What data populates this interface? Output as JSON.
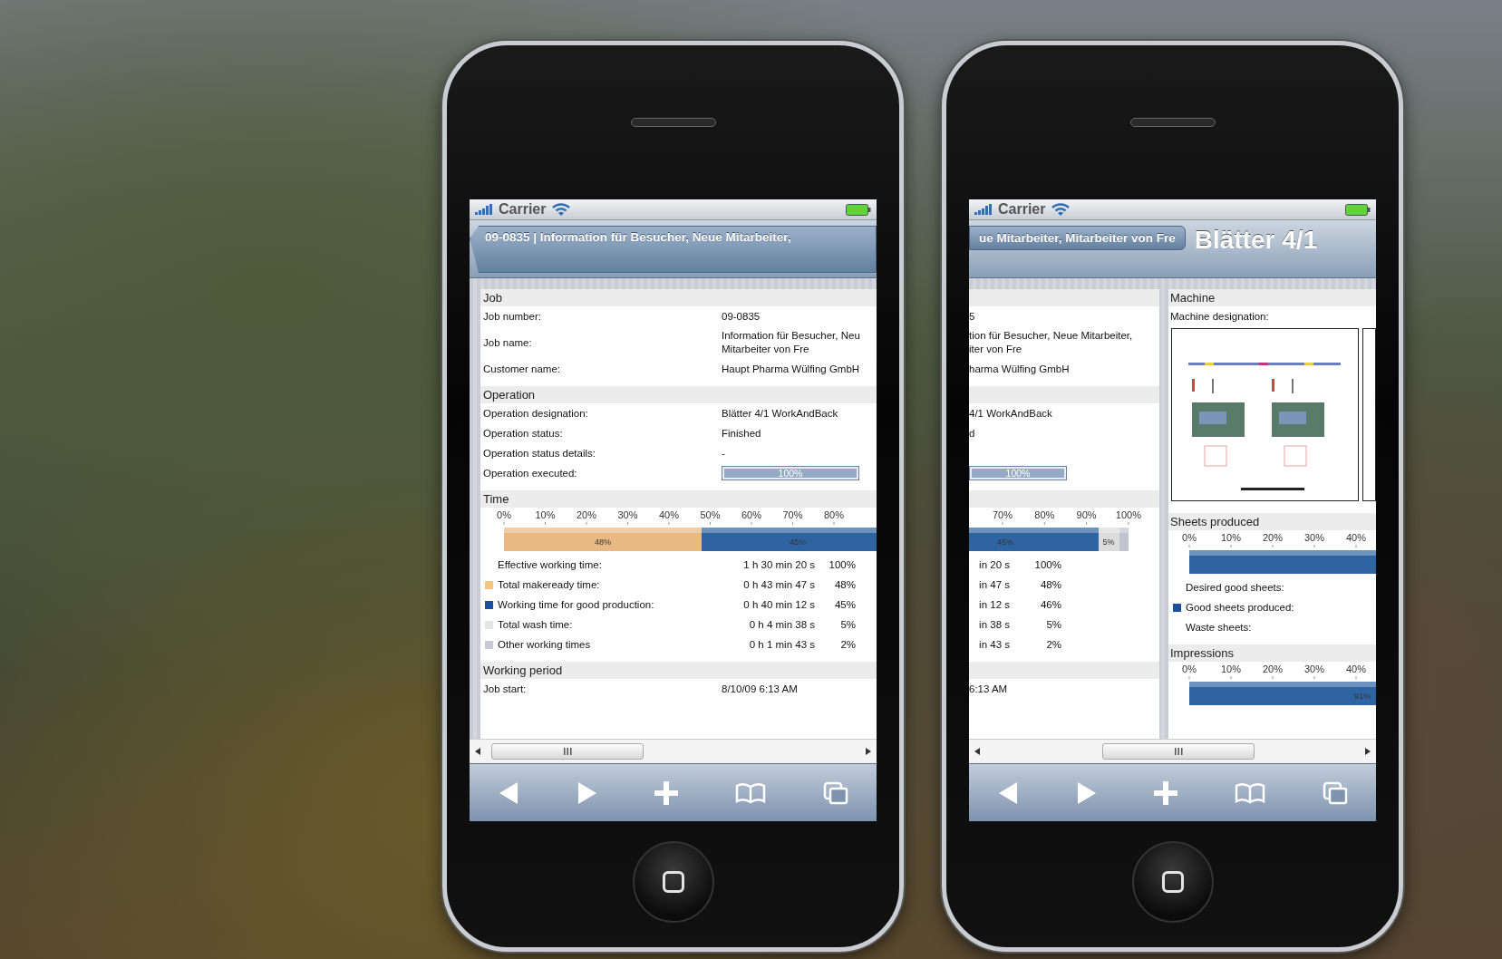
{
  "phones": [
    {
      "status_bar": {
        "carrier": "Carrier"
      },
      "nav": {
        "back_label": "09-0835 | Information für Besucher, Neue Mitarbeiter,"
      },
      "columns": [
        {
          "blocks": [
            {
              "kind": "info",
              "title": "Job",
              "rows": [
                {
                  "kind": "text",
                  "label": "Job number:",
                  "value": "09-0835"
                },
                {
                  "kind": "text",
                  "label": "Job name:",
                  "value_lines": [
                    "Information für Besucher, Neu",
                    "Mitarbeiter von Fre"
                  ]
                },
                {
                  "kind": "text",
                  "label": "Customer name:",
                  "value": "Haupt Pharma Wülfing GmbH"
                }
              ]
            },
            {
              "kind": "info",
              "title": "Operation",
              "rows": [
                {
                  "kind": "text",
                  "label": "Operation designation:",
                  "value": "Blätter 4/1 WorkAndBack"
                },
                {
                  "kind": "text",
                  "label": "Operation status:",
                  "value": "Finished"
                },
                {
                  "kind": "text",
                  "label": "Operation status details:",
                  "value": "-"
                },
                {
                  "kind": "progress",
                  "label": "Operation executed:",
                  "level": 1,
                  "reading": "100%"
                }
              ]
            },
            {
              "kind": "picture_chart",
              "title": "Time",
              "ticks": [
                "0%",
                "10%",
                "20%",
                "30%",
                "40%",
                "50%",
                "60%",
                "70%",
                "80%"
              ],
              "segments": [
                {
                  "color": "#e9b983",
                  "label": "48%"
                },
                {
                  "color": "#2f64a3",
                  "label": "45%"
                }
              ],
              "legend": [
                {
                  "label": "Effective working time:",
                  "time": "1 h 30 min 20 s",
                  "percent": "100%"
                },
                {
                  "color": "#f5c27f",
                  "label": "Total makeready time:",
                  "time": "0 h 43 min 47 s",
                  "percent": "48%"
                },
                {
                  "color": "#1d4f9c",
                  "label": "Working time for good production:",
                  "time": "0 h 40 min 12 s",
                  "percent": "45%"
                },
                {
                  "color": "#e6e6e6",
                  "label": "Total wash time:",
                  "time": "0 h 4 min 38 s",
                  "percent": "5%"
                },
                {
                  "color": "#c9c9d6",
                  "label": "Other working times",
                  "time": "0 h 1 min 43 s",
                  "percent": "2%"
                }
              ]
            },
            {
              "kind": "info",
              "title": "Working period",
              "rows": [
                {
                  "kind": "text",
                  "label": "Job start:",
                  "value": "8/10/09 6:13 AM"
                }
              ]
            }
          ]
        }
      ]
    },
    {
      "status_bar": {
        "carrier": "Carrier"
      },
      "nav": {
        "back_label": "ue Mitarbeiter, Mitarbeiter von Fre",
        "title": "Blätter 4/1"
      },
      "columns": [
        {
          "blocks": [
            {
              "kind": "info",
              "rows": [
                {
                  "kind": "text",
                  "value": "5"
                },
                {
                  "kind": "text",
                  "value_lines": [
                    "tion für Besucher, Neue Mitarbeiter,",
                    "iter von Fre"
                  ]
                },
                {
                  "kind": "text",
                  "value": "harma Wülfing GmbH"
                }
              ]
            },
            {
              "kind": "info",
              "rows": [
                {
                  "kind": "text",
                  "value": "4/1 WorkAndBack"
                },
                {
                  "kind": "text",
                  "value": "d"
                },
                {
                  "kind": "spacer"
                },
                {
                  "kind": "progress",
                  "level": 1,
                  "reading": "100%"
                }
              ]
            },
            {
              "kind": "picture_chart",
              "ticks": [
                "70%",
                "80%",
                "90%",
                "100%"
              ],
              "segments": [
                {
                  "color": "#2f64a3",
                  "label": "45%"
                },
                {
                  "color": "#dcdcdc",
                  "label": "5%"
                },
                {
                  "color": "#c3c3cf"
                }
              ],
              "legend": [
                {
                  "time": "in 20 s",
                  "percent": "100%"
                },
                {
                  "time": "in 47 s",
                  "percent": "48%"
                },
                {
                  "time": "in 12 s",
                  "percent": "46%"
                },
                {
                  "time": "in 38 s",
                  "percent": "5%"
                },
                {
                  "time": "in 43 s",
                  "percent": "2%"
                }
              ]
            },
            {
              "kind": "info",
              "rows": [
                {
                  "kind": "text",
                  "value": "6:13 AM"
                }
              ]
            }
          ]
        },
        {
          "blocks": [
            {
              "kind": "image",
              "title": "Machine",
              "label": "Machine designation:"
            },
            {
              "kind": "picture_chart",
              "title": "Sheets produced",
              "ticks": [
                "0%",
                "10%",
                "20%",
                "30%",
                "40%"
              ],
              "segments": [
                {
                  "color": "#2f64a3"
                }
              ],
              "legend": [
                {
                  "label": "Desired good sheets:"
                },
                {
                  "color": "#1d4f9c",
                  "label": "Good sheets produced:"
                },
                {
                  "label": "Waste sheets:"
                }
              ]
            },
            {
              "kind": "picture_chart",
              "title": "Impressions",
              "ticks": [
                "0%",
                "10%",
                "20%",
                "30%",
                "40%"
              ],
              "segments": [
                {
                  "color": "#2f64a3",
                  "label": "91%"
                }
              ]
            }
          ]
        }
      ]
    }
  ]
}
